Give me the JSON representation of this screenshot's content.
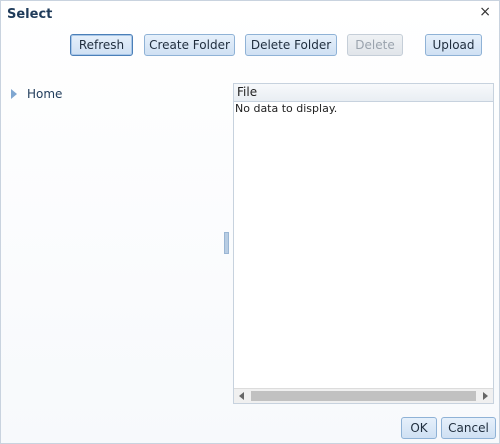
{
  "dialog": {
    "title": "Select",
    "close_glyph": "×"
  },
  "toolbar": {
    "refresh_label": "Refresh",
    "create_folder_label": "Create Folder",
    "delete_folder_label": "Delete Folder",
    "delete_label": "Delete",
    "upload_label": "Upload"
  },
  "tree": {
    "items": [
      {
        "label": "Home",
        "icon": "expand-arrow-icon"
      }
    ]
  },
  "table": {
    "columns": [
      "File"
    ],
    "empty_message": "No data to display."
  },
  "footer": {
    "ok_label": "OK",
    "cancel_label": "Cancel"
  },
  "colors": {
    "button_border": "#8fb2d6",
    "title": "#1f3b5a",
    "disabled_text": "#9aa3ad"
  }
}
